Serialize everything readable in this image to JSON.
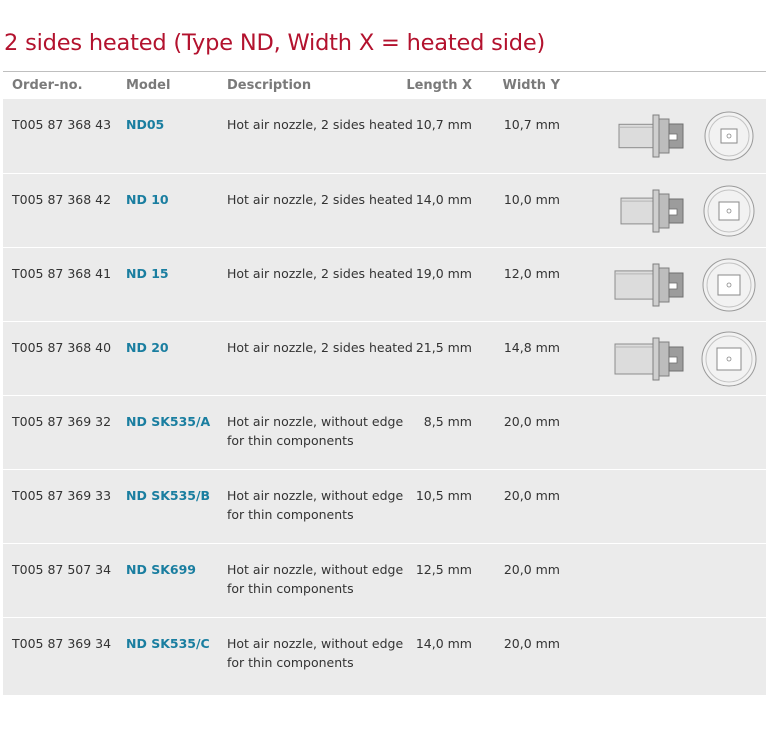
{
  "title": "2 sides heated (Type ND, Width X = heated side)",
  "columns": {
    "order": "Order-no.",
    "model": "Model",
    "description": "Description",
    "length": "Length X",
    "width": "Width Y"
  },
  "rows": [
    {
      "order": "T005 87 368 43",
      "model": "ND05",
      "desc1": "Hot air nozzle, 2 sides heated",
      "desc2": "",
      "length": "10,7 mm",
      "width": "10,7 mm",
      "image": "nozzle-nd05"
    },
    {
      "order": "T005 87 368 42",
      "model": "ND 10",
      "desc1": "Hot air nozzle, 2 sides heated",
      "desc2": "",
      "length": "14,0 mm",
      "width": "10,0 mm",
      "image": "nozzle-nd10"
    },
    {
      "order": "T005 87 368 41",
      "model": "ND 15",
      "desc1": "Hot air nozzle, 2 sides heated",
      "desc2": "",
      "length": "19,0 mm",
      "width": "12,0 mm",
      "image": "nozzle-nd15"
    },
    {
      "order": "T005 87 368 40",
      "model": "ND 20",
      "desc1": "Hot air nozzle, 2 sides heated",
      "desc2": "",
      "length": "21,5 mm",
      "width": "14,8 mm",
      "image": "nozzle-nd20"
    },
    {
      "order": "T005 87 369 32",
      "model": "ND SK535/A",
      "desc1": "Hot air nozzle, without edge",
      "desc2": "for thin components",
      "length": "8,5 mm",
      "width": "20,0 mm",
      "image": ""
    },
    {
      "order": "T005 87 369 33",
      "model": "ND SK535/B",
      "desc1": "Hot air nozzle, without edge",
      "desc2": "for thin components",
      "length": "10,5 mm",
      "width": "20,0 mm",
      "image": ""
    },
    {
      "order": "T005 87 507 34",
      "model": "ND SK699",
      "desc1": "Hot air nozzle, without edge",
      "desc2": "for thin components",
      "length": "12,5 mm",
      "width": "20,0 mm",
      "image": ""
    },
    {
      "order": "T005 87 369 34",
      "model": "ND SK535/C",
      "desc1": "Hot air nozzle, without edge",
      "desc2": "for thin components",
      "length": "14,0 mm",
      "width": "20,0 mm",
      "image": ""
    }
  ]
}
